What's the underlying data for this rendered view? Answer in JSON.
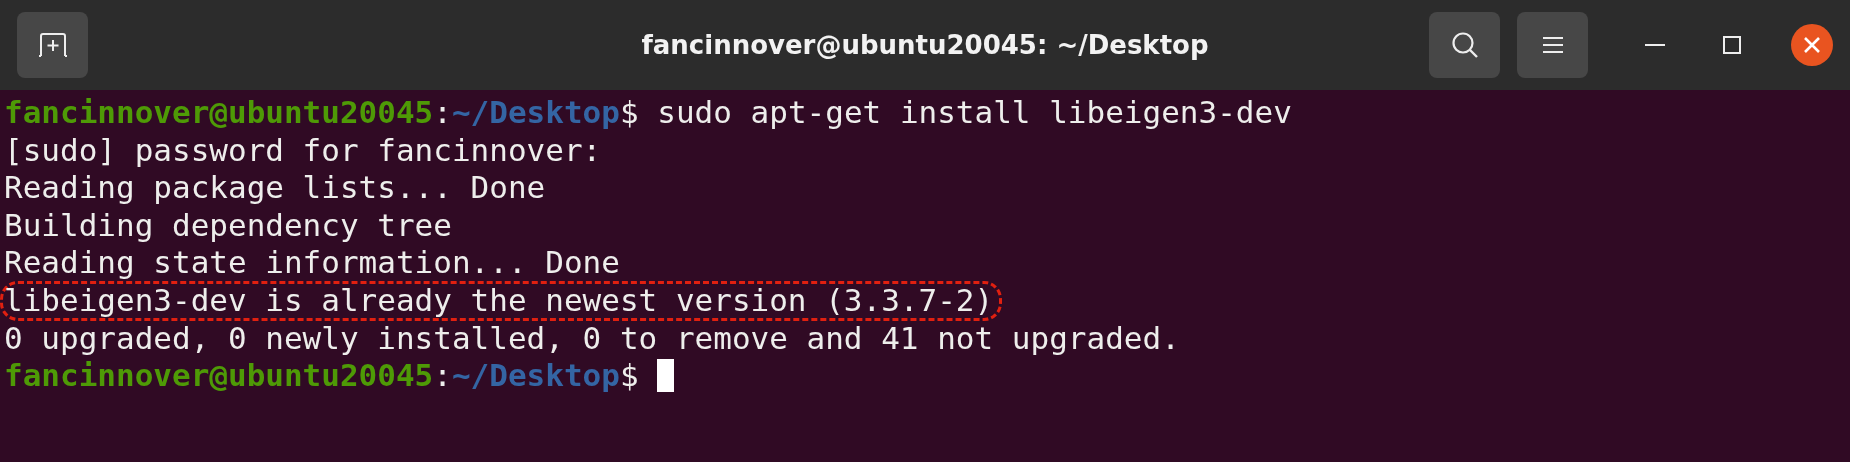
{
  "window": {
    "title": "fancinnover@ubuntu20045: ~/Desktop"
  },
  "terminal": {
    "lines": [
      {
        "kind": "prompt",
        "user_host": "fancinnover@ubuntu20045",
        "separator": ":",
        "path": "~/Desktop",
        "symbol": "$",
        "command": " sudo apt-get install libeigen3-dev",
        "cursor": false
      },
      {
        "kind": "output",
        "text": "[sudo] password for fancinnover:",
        "circled": false
      },
      {
        "kind": "output",
        "text": "Reading package lists... Done",
        "circled": false
      },
      {
        "kind": "output",
        "text": "Building dependency tree",
        "circled": false
      },
      {
        "kind": "output",
        "text": "Reading state information... Done",
        "circled": false
      },
      {
        "kind": "output",
        "text": "libeigen3-dev is already the newest version (3.3.7-2)",
        "circled": true
      },
      {
        "kind": "output",
        "text": "0 upgraded, 0 newly installed, 0 to remove and 41 not upgraded.",
        "circled": false
      },
      {
        "kind": "prompt",
        "user_host": "fancinnover@ubuntu20045",
        "separator": ":",
        "path": "~/Desktop",
        "symbol": "$",
        "cursor": true
      }
    ]
  }
}
